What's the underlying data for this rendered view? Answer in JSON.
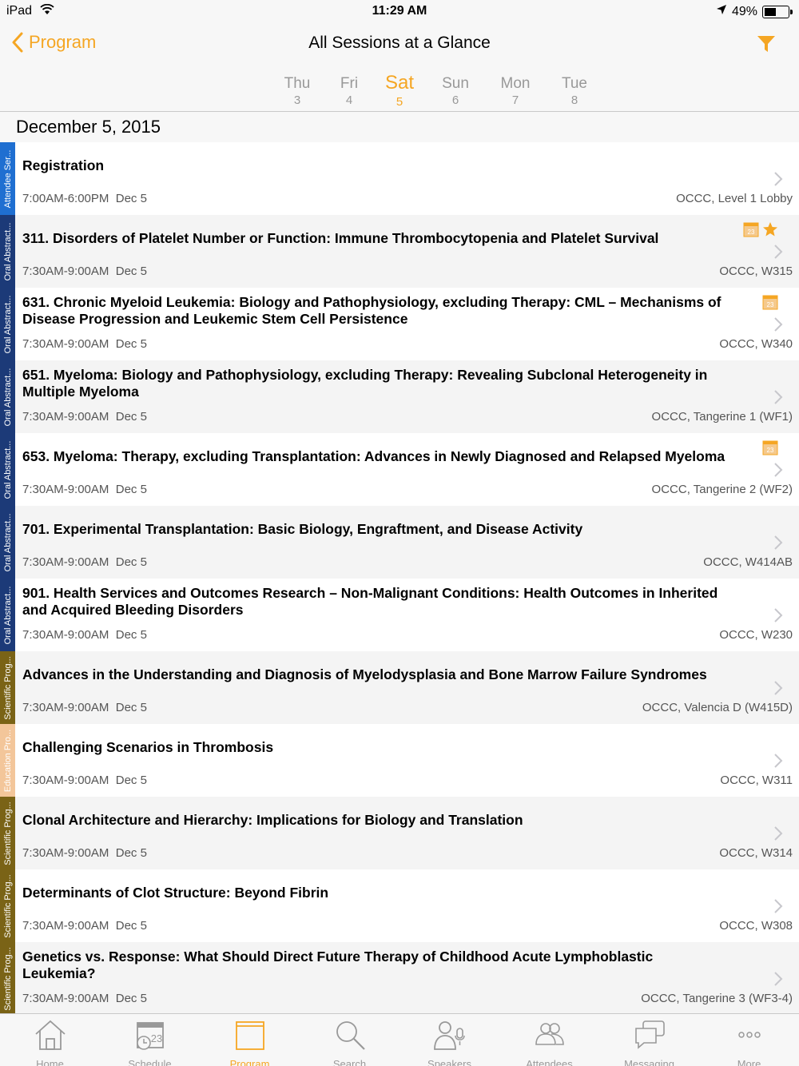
{
  "status": {
    "device": "iPad",
    "time": "11:29 AM",
    "battery": "49%"
  },
  "nav": {
    "back_label": "Program",
    "title": "All Sessions at a Glance"
  },
  "days": [
    {
      "name": "Thu",
      "date": "3",
      "active": false
    },
    {
      "name": "Fri",
      "date": "4",
      "active": false
    },
    {
      "name": "Sat",
      "date": "5",
      "active": true
    },
    {
      "name": "Sun",
      "date": "6",
      "active": false
    },
    {
      "name": "Mon",
      "date": "7",
      "active": false
    },
    {
      "name": "Tue",
      "date": "8",
      "active": false
    }
  ],
  "date_header": "December 5, 2015",
  "colors": {
    "accent": "#f5a623",
    "attendee": "#1f6fd1",
    "oral": "#1c3a78",
    "scientific": "#7a6316",
    "education": "#f3c69a"
  },
  "sessions": [
    {
      "category": "Attendee Ser...",
      "cat_color": "#1f6fd1",
      "title": "Registration",
      "time": "7:00AM-6:00PM",
      "date": "Dec 5",
      "location": "OCCC, Level 1 Lobby",
      "calendar": false,
      "starred": false
    },
    {
      "category": "Oral Abstract...",
      "cat_color": "#1c3a78",
      "title": "311. Disorders of Platelet Number or Function: Immune Thrombocytopenia and Platelet Survival",
      "time": "7:30AM-9:00AM",
      "date": "Dec 5",
      "location": "OCCC, W315",
      "calendar": true,
      "starred": true
    },
    {
      "category": "Oral Abstract...",
      "cat_color": "#1c3a78",
      "title": "631. Chronic Myeloid Leukemia: Biology and Pathophysiology, excluding Therapy: CML – Mechanisms of Disease Progression and Leukemic Stem Cell Persistence",
      "time": "7:30AM-9:00AM",
      "date": "Dec 5",
      "location": "OCCC, W340",
      "calendar": true,
      "starred": false
    },
    {
      "category": "Oral Abstract...",
      "cat_color": "#1c3a78",
      "title": "651. Myeloma: Biology and Pathophysiology, excluding Therapy: Revealing Subclonal Heterogeneity in Multiple Myeloma",
      "time": "7:30AM-9:00AM",
      "date": "Dec 5",
      "location": "OCCC, Tangerine 1 (WF1)",
      "calendar": false,
      "starred": false
    },
    {
      "category": "Oral Abstract...",
      "cat_color": "#1c3a78",
      "title": "653. Myeloma: Therapy, excluding Transplantation: Advances in Newly Diagnosed and Relapsed Myeloma",
      "time": "7:30AM-9:00AM",
      "date": "Dec 5",
      "location": "OCCC, Tangerine 2 (WF2)",
      "calendar": true,
      "starred": false
    },
    {
      "category": "Oral Abstract...",
      "cat_color": "#1c3a78",
      "title": "701. Experimental Transplantation: Basic Biology, Engraftment, and Disease Activity",
      "time": "7:30AM-9:00AM",
      "date": "Dec 5",
      "location": "OCCC, W414AB",
      "calendar": false,
      "starred": false
    },
    {
      "category": "Oral Abstract...",
      "cat_color": "#1c3a78",
      "title": "901. Health Services and Outcomes Research – Non-Malignant Conditions: Health Outcomes in Inherited and Acquired Bleeding Disorders",
      "time": "7:30AM-9:00AM",
      "date": "Dec 5",
      "location": "OCCC, W230",
      "calendar": false,
      "starred": false
    },
    {
      "category": "Scientific Prog...",
      "cat_color": "#7a6316",
      "title": "Advances in the Understanding and Diagnosis of Myelodysplasia and Bone Marrow Failure Syndromes",
      "time": "7:30AM-9:00AM",
      "date": "Dec 5",
      "location": "OCCC, Valencia D (W415D)",
      "calendar": false,
      "starred": false
    },
    {
      "category": "Education Pro...",
      "cat_color": "#f3c69a",
      "title": "Challenging Scenarios in Thrombosis",
      "time": "7:30AM-9:00AM",
      "date": "Dec 5",
      "location": "OCCC, W311",
      "calendar": false,
      "starred": false
    },
    {
      "category": "Scientific Prog...",
      "cat_color": "#7a6316",
      "title": "Clonal Architecture and Hierarchy: Implications  for Biology and Translation",
      "time": "7:30AM-9:00AM",
      "date": "Dec 5",
      "location": "OCCC, W314",
      "calendar": false,
      "starred": false
    },
    {
      "category": "Scientific Prog...",
      "cat_color": "#7a6316",
      "title": "Determinants of Clot Structure: Beyond Fibrin",
      "time": "7:30AM-9:00AM",
      "date": "Dec 5",
      "location": "OCCC, W308",
      "calendar": false,
      "starred": false
    },
    {
      "category": "Scientific Prog...",
      "cat_color": "#7a6316",
      "title": "Genetics vs. Response: What Should Direct Future Therapy of Childhood Acute Lymphoblastic Leukemia?",
      "time": "7:30AM-9:00AM",
      "date": "Dec 5",
      "location": "OCCC, Tangerine 3 (WF3-4)",
      "calendar": false,
      "starred": false
    }
  ],
  "tabs": [
    {
      "label": "Home",
      "icon": "home-icon",
      "active": false
    },
    {
      "label": "Schedule",
      "icon": "schedule-icon",
      "badge": "23",
      "active": false
    },
    {
      "label": "Program",
      "icon": "program-icon",
      "active": true
    },
    {
      "label": "Search",
      "icon": "search-icon",
      "active": false
    },
    {
      "label": "Speakers",
      "icon": "speakers-icon",
      "active": false
    },
    {
      "label": "Attendees",
      "icon": "attendees-icon",
      "active": false
    },
    {
      "label": "Messaging",
      "icon": "messaging-icon",
      "active": false
    },
    {
      "label": "More",
      "icon": "more-icon",
      "active": false
    }
  ]
}
